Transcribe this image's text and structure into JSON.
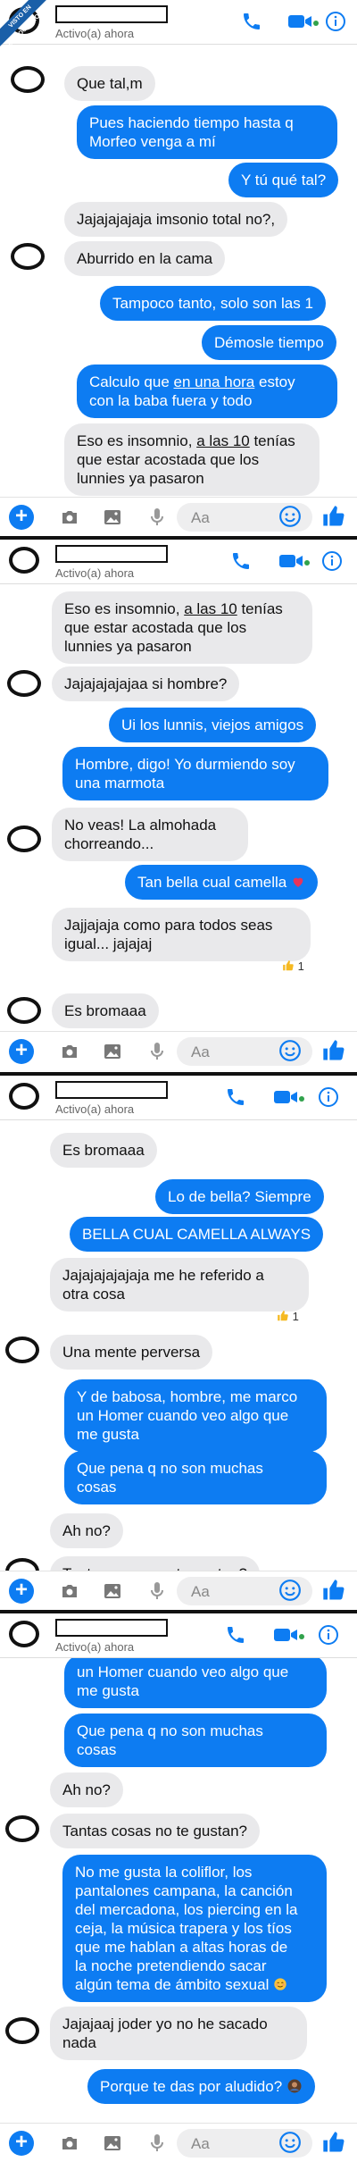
{
  "watermark": "VISTO EN CUANTOCABRON.COM",
  "colors": {
    "accent": "#0d7cf2",
    "incoming_bubble": "#e9e9eb",
    "online": "#31a24c"
  },
  "header": {
    "status": "Activo(a) ahora"
  },
  "composer": {
    "placeholder": "Aa"
  },
  "panels": [
    {
      "messages": [
        {
          "dir": "in",
          "text": "Que tal,m"
        },
        {
          "dir": "out",
          "text": "Pues haciendo tiempo hasta q\nMorfeo venga a mí"
        },
        {
          "dir": "out",
          "text": "Y tú qué tal?"
        },
        {
          "dir": "in",
          "text": "Jajajajajaja imsonio total no?,"
        },
        {
          "dir": "in",
          "text": "Aburrido en la cama"
        },
        {
          "dir": "out",
          "text": "Tampoco tanto, solo son las 1"
        },
        {
          "dir": "out",
          "text": "Démosle tiempo"
        },
        {
          "dir": "out",
          "pre": "Calculo que ",
          "u": "en una hora",
          "post": " estoy\ncon la baba fuera y todo"
        },
        {
          "dir": "in",
          "pre": "Eso es insomnio, ",
          "u": "a las 10",
          "post": " tenías\nque estar acostada que los\nlunnies ya pasaron"
        }
      ]
    },
    {
      "messages": [
        {
          "dir": "in",
          "pre": "Eso es insomnio, ",
          "u": "a las 10",
          "post": " tenías\nque estar acostada que los\nlunnies ya pasaron"
        },
        {
          "dir": "in",
          "text": "Jajajajajajaa si hombre?"
        },
        {
          "dir": "out",
          "text": "Ui los lunnis, viejos amigos"
        },
        {
          "dir": "out",
          "text": "Hombre, digo! Yo durmiendo soy\nuna marmota"
        },
        {
          "dir": "in",
          "text": "No veas! La almohada\nchorreando..."
        },
        {
          "dir": "out",
          "text": "Tan bella cual camella"
        },
        {
          "dir": "in",
          "text": "Jajjajaja como para todos seas\nigual... jajajaj"
        },
        {
          "dir": "in",
          "text": "Es bromaaa"
        }
      ],
      "reaction_count": "1"
    },
    {
      "messages": [
        {
          "dir": "in",
          "text": "Es bromaaa"
        },
        {
          "dir": "out",
          "text": "Lo de bella? Siempre"
        },
        {
          "dir": "out",
          "text": "BELLA CUAL CAMELLA ALWAYS"
        },
        {
          "dir": "in",
          "text": "Jajajajajajaja me he referido a\notra cosa"
        },
        {
          "dir": "in",
          "text": "Una mente perversa"
        },
        {
          "dir": "out",
          "text": "Y de babosa, hombre, me marco\nun Homer cuando veo algo que\nme gusta"
        },
        {
          "dir": "out",
          "text": "Que pena q no son  muchas\ncosas"
        },
        {
          "dir": "in",
          "text": "Ah no?"
        },
        {
          "dir": "in",
          "text": "Tantas cosas no te gustan?"
        }
      ],
      "reaction_count": "1"
    },
    {
      "messages": [
        {
          "dir": "out",
          "text": "un Homer cuando veo algo que\nme gusta"
        },
        {
          "dir": "out",
          "text": "Que pena q no son  muchas\ncosas"
        },
        {
          "dir": "in",
          "text": "Ah no?"
        },
        {
          "dir": "in",
          "text": "Tantas cosas no te gustan?"
        },
        {
          "dir": "out",
          "text": "No me gusta la coliflor, los\npantalones campana, la canción\ndel mercadona, los piercing en la\nceja, la música trapera y los tíos\nque me hablan a altas horas de\nla noche pretendiendo sacar\nalgún tema de ámbito sexual"
        },
        {
          "dir": "in",
          "text": "Jajajaaj joder yo no he sacado\nnada"
        },
        {
          "dir": "out",
          "text": "Porque te das por aludido?"
        }
      ]
    }
  ]
}
